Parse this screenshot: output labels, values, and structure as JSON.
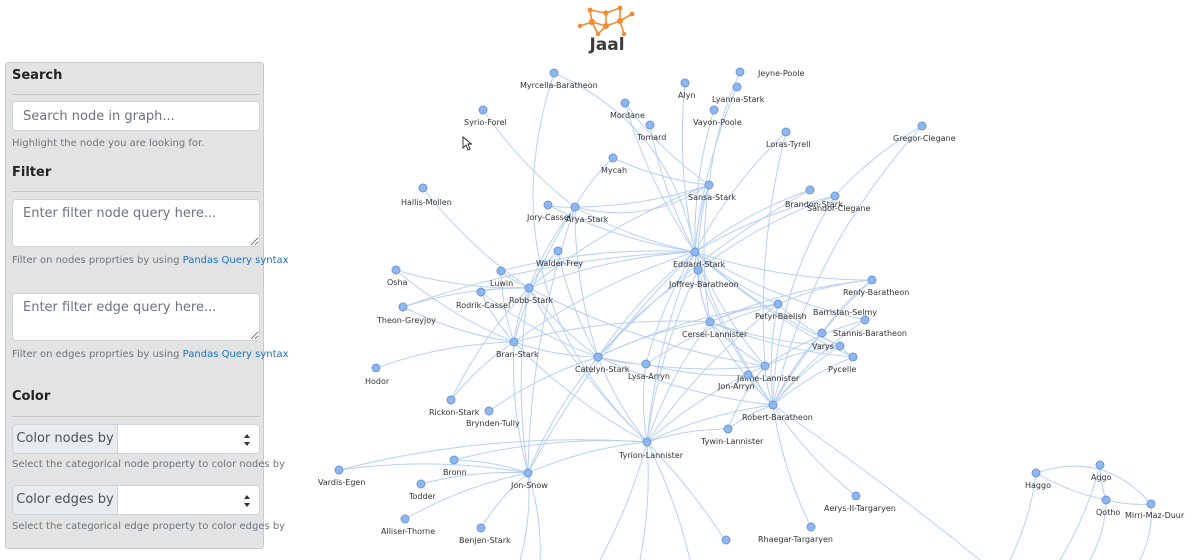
{
  "app": {
    "name": "Jaal",
    "accent_color": "#f28a30"
  },
  "sidebar": {
    "search": {
      "heading": "Search",
      "placeholder": "Search node in graph...",
      "help": "Highlight the node you are looking for."
    },
    "filter": {
      "heading": "Filter",
      "node_placeholder": "Enter filter node query here...",
      "node_help_prefix": "Filter on nodes proprties by using",
      "edge_placeholder": "Enter filter edge query here...",
      "edge_help_prefix": "Filter on edges proprties by using",
      "link_text": "Pandas Query syntax"
    },
    "color": {
      "heading": "Color",
      "nodes_label": "Color nodes by",
      "nodes_value": "",
      "nodes_help": "Select the categorical node property to color nodes by",
      "edges_label": "Color edges by",
      "edges_value": "",
      "edges_help": "Select the categorical edge property to color edges by"
    }
  },
  "graph": {
    "node_color": "#8fb7ef",
    "edge_color": "#b7d0f2",
    "nodes": [
      "Myrcella-Baratheon",
      "Jeyne-Poole",
      "Alyn",
      "Lyanna-Stark",
      "Syrio-Forel",
      "Mordane",
      "Vayon-Poole",
      "Tomard",
      "Loras-Tyrell",
      "Gregor-Clegane",
      "Mycah",
      "Sansa-Stark",
      "Hallis-Mollen",
      "Jory-Cassel",
      "Arya-Stark",
      "Brandon-Stark",
      "Sandor-Clegane",
      "Walder-Frey",
      "Eddard-Stark",
      "Osha",
      "Luwin",
      "Joffrey-Baratheon",
      "Robb-Stark",
      "Rodrik-Cassel",
      "Renly-Baratheon",
      "Theon-Greyjoy",
      "Petyr-Baelish",
      "Barristan-Selmy",
      "Cersei-Lannister",
      "Stannis-Baratheon",
      "Varys",
      "Bran-Stark",
      "Hodor",
      "Catelyn-Stark",
      "Lysa-Arryn",
      "Pycelle",
      "Jaime-Lannister",
      "Jon-Arryn",
      "Robert-Baratheon",
      "Rickon-Stark",
      "Brynden-Tully",
      "Tywin-Lannister",
      "Tyrion-Lannister",
      "Bronn",
      "Vardis-Egen",
      "Jon-Snow",
      "Todder",
      "Aerys-II-Targaryen",
      "Alliser-Thorne",
      "Benjen-Stark",
      "Rhaegar-Targaryen",
      "Haggo",
      "Aggo",
      "Qotho",
      "Mirri-Maz-Duur"
    ]
  }
}
